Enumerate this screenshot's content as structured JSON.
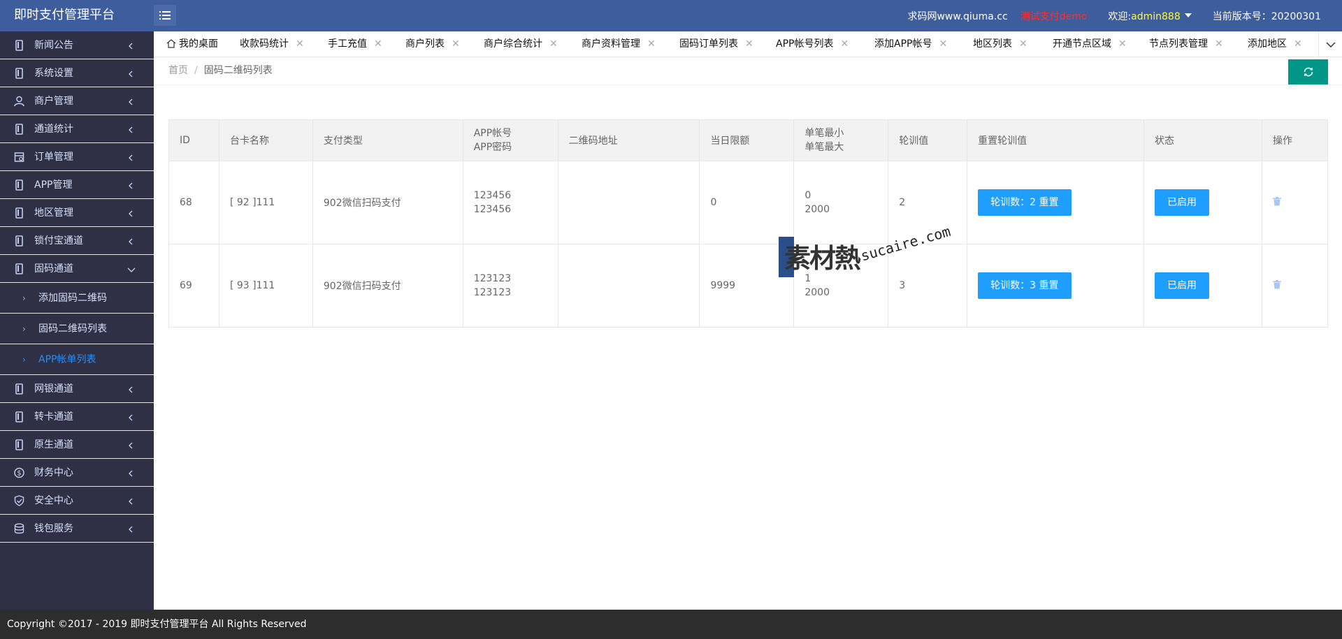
{
  "header": {
    "app_title": "即时支付管理平台",
    "site_text": "求码网www.qiuma.cc",
    "test_text": "测试支付demo",
    "welcome_label": "欢迎:",
    "username": "admin888",
    "version_text": "当前版本号：20200301"
  },
  "sidebar": {
    "items": [
      {
        "label": "新闻公告",
        "icon": "phone-icon"
      },
      {
        "label": "系统设置",
        "icon": "phone-icon"
      },
      {
        "label": "商户管理",
        "icon": "user-icon"
      },
      {
        "label": "通道统计",
        "icon": "phone-icon"
      },
      {
        "label": "订单管理",
        "icon": "calendar-icon"
      },
      {
        "label": "APP管理",
        "icon": "phone-icon"
      },
      {
        "label": "地区管理",
        "icon": "phone-icon"
      },
      {
        "label": "锁付宝通道",
        "icon": "phone-icon"
      },
      {
        "label": "固码通道",
        "icon": "phone-icon"
      }
    ],
    "sub_items": [
      {
        "label": "添加固码二维码"
      },
      {
        "label": "固码二维码列表"
      },
      {
        "label": "APP帐单列表"
      }
    ],
    "items_after": [
      {
        "label": "网银通道",
        "icon": "phone-icon"
      },
      {
        "label": "转卡通道",
        "icon": "phone-icon"
      },
      {
        "label": "原生通道",
        "icon": "phone-icon"
      },
      {
        "label": "财务中心",
        "icon": "dollar-icon"
      },
      {
        "label": "安全中心",
        "icon": "shield-icon"
      },
      {
        "label": "钱包服务",
        "icon": "database-icon"
      }
    ]
  },
  "tabs": [
    "我的桌面",
    "收款码统计",
    "手工充值",
    "商户列表",
    "商户综合统计",
    "商户资料管理",
    "固码订单列表",
    "APP帐号列表",
    "添加APP帐号",
    "地区列表",
    "开通节点区域",
    "节点列表管理",
    "添加地区"
  ],
  "breadcrumb": {
    "home": "首页",
    "separator": "/",
    "current": "固码二维码列表"
  },
  "table": {
    "headers": {
      "id": "ID",
      "card_name": "台卡名称",
      "pay_type": "支付类型",
      "app_account": "APP帐号",
      "app_password": "APP密码",
      "qr_url": "二维码地址",
      "daily_limit": "当日限额",
      "min_single": "单笔最小",
      "max_single": "单笔最大",
      "rotation": "轮训值",
      "reset_rotation": "重置轮训值",
      "status": "状态",
      "actions": "操作"
    },
    "rows": [
      {
        "id": "68",
        "card_name": "[ 92 ]111",
        "pay_type": "902微信扫码支付",
        "app_account": "123456",
        "app_password": "123456",
        "qr_url": "",
        "daily_limit": "0",
        "min": "0",
        "max": "2000",
        "rotation": "2",
        "reset_label": "轮训数：2 重置",
        "status_label": "已启用"
      },
      {
        "id": "69",
        "card_name": "[ 93 ]111",
        "pay_type": "902微信扫码支付",
        "app_account": "123123",
        "app_password": "123123",
        "qr_url": "",
        "daily_limit": "9999",
        "min": "1",
        "max": "2000",
        "rotation": "3",
        "reset_label": "轮训数：3 重置",
        "status_label": "已启用"
      }
    ]
  },
  "watermark": {
    "cn": "素材熱",
    "en": "sucaire.com"
  },
  "footer": {
    "text": "Copyright ©2017 - 2019 即时支付管理平台 All Rights Reserved"
  },
  "colors": {
    "header_bg": "#3e5d9c",
    "sidebar_bg": "#2f3045",
    "accent": "#1e9fff",
    "refresh": "#009688",
    "username": "#fdfb3a",
    "test_link": "#ff2d2d"
  }
}
